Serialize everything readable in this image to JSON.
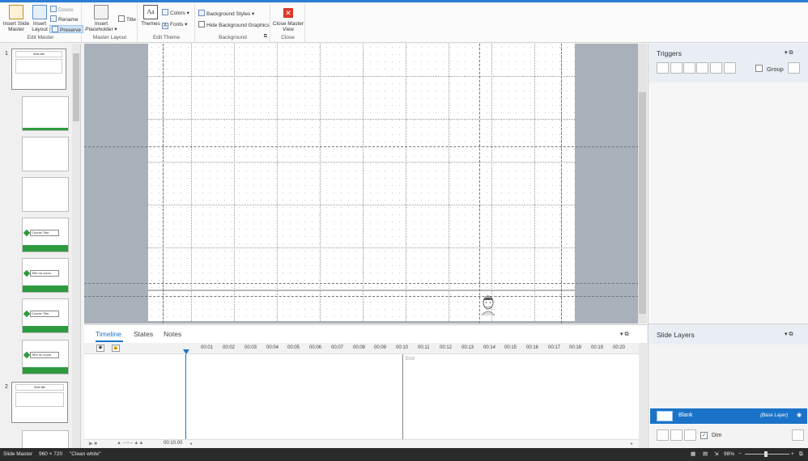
{
  "ribbon": {
    "edit_master": {
      "group_label": "Edit Master",
      "insert_slide_master": "Insert Slide Master",
      "insert_layout": "Insert Layout",
      "delete": "Delete",
      "rename": "Rename",
      "preserve": "Preserve"
    },
    "master_layout": {
      "group_label": "Master Layout",
      "insert_placeholder": "Insert Placeholder",
      "title": "Title"
    },
    "edit_theme": {
      "group_label": "Edit Theme",
      "themes": "Themes",
      "colors": "Colors",
      "fonts": "Fonts"
    },
    "background": {
      "group_label": "Background",
      "background_styles": "Background Styles",
      "hide_background_graphics": "Hide Background Graphics"
    },
    "close": {
      "group_label": "Close",
      "close_master_view": "Close Master View"
    }
  },
  "slide_panel": {
    "masters": [
      {
        "number": "1",
        "thumb_title": "Slide title"
      },
      {
        "number": "2",
        "thumb_title": "Slide title"
      }
    ],
    "layouts": [
      {
        "label": ""
      },
      {
        "label": ""
      },
      {
        "label": ""
      },
      {
        "label": "Course Title"
      },
      {
        "label": "Title du cours"
      },
      {
        "label": "Course Title"
      },
      {
        "label": "Titre du cours"
      }
    ]
  },
  "timeline": {
    "tabs": [
      "Timeline",
      "States",
      "Notes"
    ],
    "ticks": [
      "00:01",
      "00:02",
      "00:03",
      "00:04",
      "00:05",
      "00:06",
      "00:07",
      "00:08",
      "00:09",
      "00:10",
      "00:11",
      "00:12",
      "00:13",
      "00:14",
      "00:15",
      "00:16",
      "00:17",
      "00:18",
      "00:19",
      "00:20"
    ],
    "end_label": "End",
    "duration": "00:10.00"
  },
  "triggers": {
    "title": "Triggers",
    "group_label": "Group"
  },
  "slide_layers": {
    "title": "Slide Layers",
    "layer_name": "Blank",
    "layer_type": "(Base Layer)",
    "dim_label": "Dim"
  },
  "status_bar": {
    "view": "Slide Master",
    "size": "960 × 720",
    "theme": "\"Clean white\"",
    "zoom": "98%"
  },
  "colors": {
    "accent": "#2b7cd3",
    "selected_layer": "#1a73c8",
    "thumb_green": "#2e9a3e",
    "close_red": "#d9382b"
  }
}
